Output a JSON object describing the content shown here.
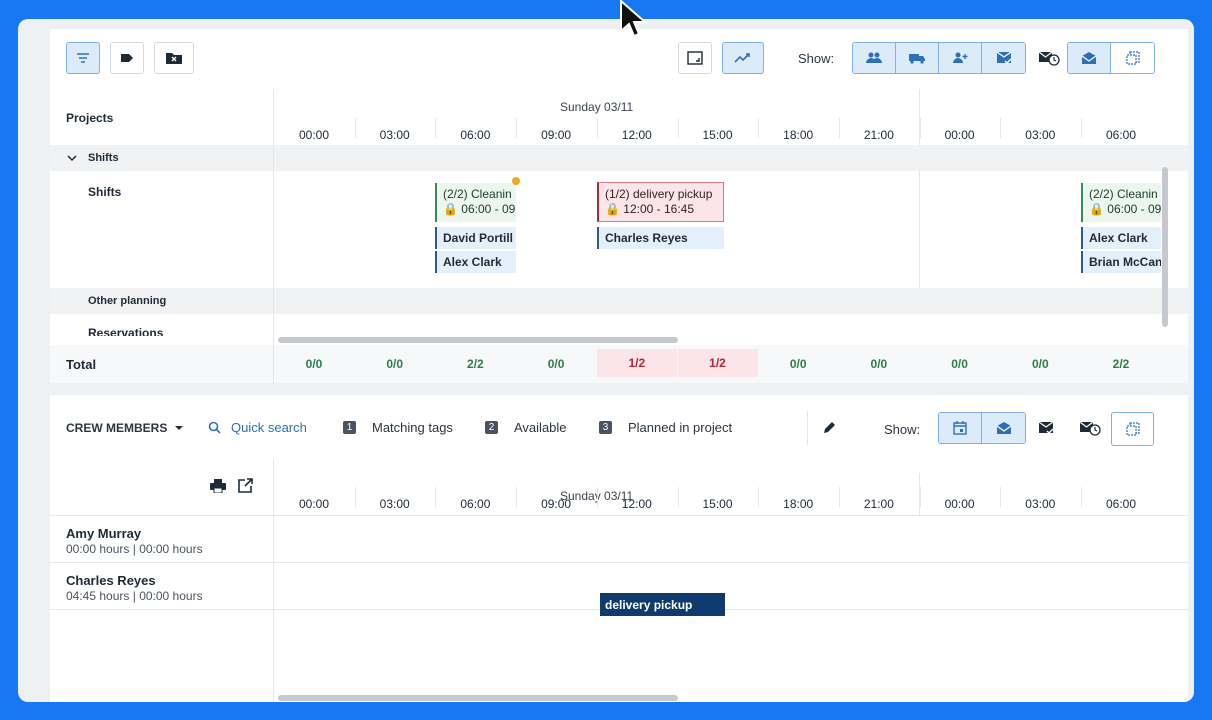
{
  "colors": {
    "background": "#1877f2",
    "accent": "#2f80d8",
    "green": "#2e7d4a",
    "red": "#b3263a",
    "navy": "#0f3a6e"
  },
  "toolbar": {
    "left_buttons": [
      "filter-icon",
      "tag-icon",
      "folder-x-icon"
    ],
    "view_buttons": [
      "fullscreen-icon",
      "trend-icon"
    ],
    "show_label": "Show:",
    "show_icons": [
      "users-icon",
      "truck-icon",
      "add-user-icon",
      "mail-check-icon",
      "mail-clock-icon",
      "inbox-icon",
      "copy-icon"
    ]
  },
  "projects": {
    "header": "Projects",
    "date": "Sunday 03/11",
    "hours": [
      "00:00",
      "03:00",
      "06:00",
      "09:00",
      "12:00",
      "15:00",
      "18:00",
      "21:00",
      "00:00",
      "03:00",
      "06:00"
    ],
    "group_label": "Shifts",
    "row_label": "Shifts",
    "other_planning": "Other planning",
    "reservations": "Reservations",
    "total_label": "Total",
    "totals": [
      "0/0",
      "0/0",
      "2/2",
      "0/0",
      "1/2",
      "1/2",
      "0/0",
      "0/0",
      "0/0",
      "0/0",
      "2/2"
    ],
    "shifts": [
      {
        "title": "(2/2) Cleanin",
        "time": "06:00 - 09",
        "crew": [
          "David Portill",
          "Alex Clark"
        ]
      },
      {
        "title": "(1/2) delivery pickup",
        "time": "12:00 - 16:45",
        "crew": [
          "Charles Reyes"
        ]
      },
      {
        "title": "(2/2) Cleanin",
        "time": "06:00 - 09",
        "crew": [
          "Alex Clark",
          "Brian McCan"
        ]
      }
    ]
  },
  "crew": {
    "title": "CREW MEMBERS",
    "quick_search": "Quick search",
    "filters": [
      {
        "num": "1",
        "label": "Matching tags"
      },
      {
        "num": "2",
        "label": "Available"
      },
      {
        "num": "3",
        "label": "Planned in project"
      }
    ],
    "show_label": "Show:",
    "date": "Sunday 03/11",
    "hours": [
      "00:00",
      "03:00",
      "06:00",
      "09:00",
      "12:00",
      "15:00",
      "18:00",
      "21:00",
      "00:00",
      "03:00",
      "06:00"
    ],
    "members": [
      {
        "name": "Amy Murray",
        "hours_a": "00:00 hours",
        "hours_b": "00:00 hours"
      },
      {
        "name": "Charles Reyes",
        "hours_a": "04:45 hours",
        "hours_b": "00:00 hours"
      }
    ],
    "task": "delivery pickup"
  }
}
